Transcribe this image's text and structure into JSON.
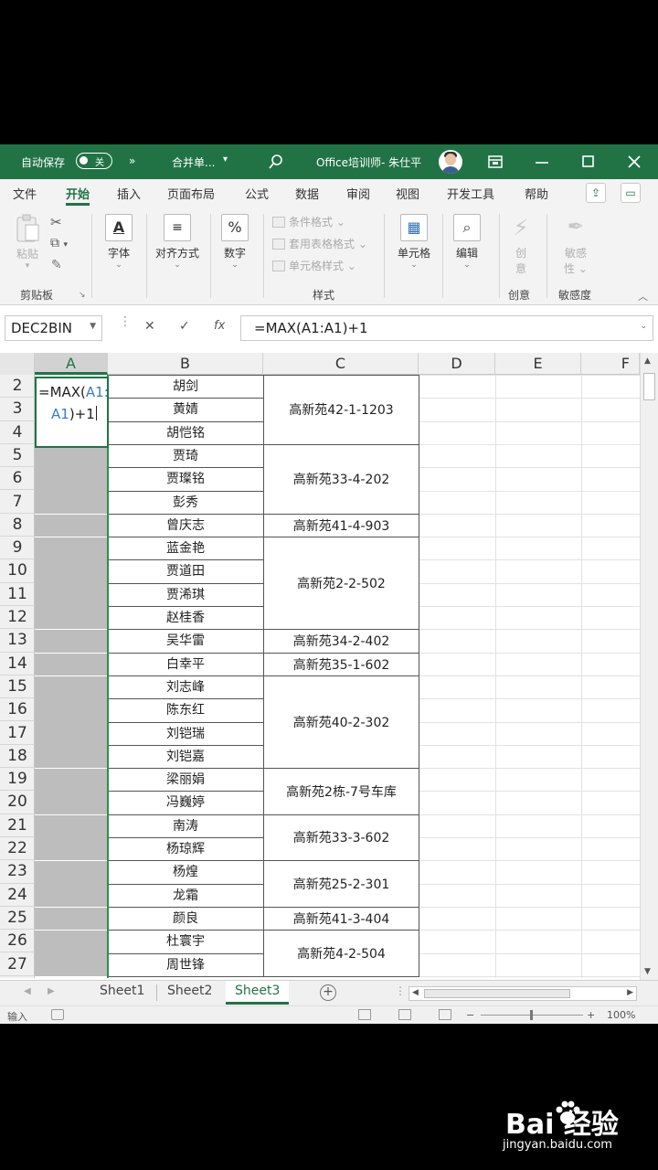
{
  "titlebar": {
    "autosave": "自动保存",
    "autosave_state": "关",
    "more": "»",
    "merge_menu": "合并单...",
    "merge_arrow": "▾",
    "doc_title": "Office培训师- 朱仕平",
    "colors": {
      "title_bg": "#217346"
    }
  },
  "tabs": [
    "文件",
    "开始",
    "插入",
    "页面布局",
    "公式",
    "数据",
    "审阅",
    "视图",
    "开发工具",
    "帮助"
  ],
  "active_tab": "开始",
  "ribbon": {
    "paste": "粘贴",
    "clipboard_group": "剪贴板",
    "font": "字体",
    "alignment": "对齐方式",
    "number": "数字",
    "cond_format": "条件格式",
    "table_format": "套用表格格式",
    "cell_style": "单元格样式",
    "styles_group": "样式",
    "cells": "单元格",
    "editing": "编辑",
    "ideas": "创意",
    "ideas_line1": "创",
    "ideas_line2": "意",
    "sensitivity": "敏感度",
    "sens_line1": "敏感",
    "sens_line2": "性",
    "percent": "%"
  },
  "formula_bar": {
    "name_box": "DEC2BIN",
    "cancel": "✕",
    "enter": "✓",
    "fx": "fx",
    "formula": "=MAX(A1:A1)+1"
  },
  "columns": [
    "A",
    "B",
    "C",
    "D",
    "E",
    "F"
  ],
  "rows": [
    "2",
    "3",
    "4",
    "5",
    "6",
    "7",
    "8",
    "9",
    "10",
    "11",
    "12",
    "13",
    "14",
    "15",
    "16",
    "17",
    "18",
    "19",
    "20",
    "21",
    "22",
    "23",
    "24",
    "25",
    "26",
    "27"
  ],
  "edit_cell": {
    "line1_prefix": "=MAX(",
    "line1_ref": "A1:",
    "line2_ref": "A1",
    "line2_suffix": ")+1"
  },
  "names": [
    "胡剑",
    "黄婧",
    "胡恺铭",
    "贾琦",
    "贾璨铭",
    "彭秀",
    "曾庆志",
    "蓝金艳",
    "贾道田",
    "贾浠琪",
    "赵桂香",
    "吴华雷",
    "白幸平",
    "刘志峰",
    "陈东红",
    "刘铠瑞",
    "刘铠嘉",
    "梁丽娟",
    "冯巍婷",
    "南涛",
    "杨琼辉",
    "杨煌",
    "龙霜",
    "颜良",
    "杜寰宇",
    "周世锋"
  ],
  "addresses": [
    "高新苑42-1-1203",
    "高新苑33-4-202",
    "高新苑41-4-903",
    "高新苑2-2-502",
    "高新苑34-2-402",
    "高新苑35-1-602",
    "高新苑40-2-302",
    "高新苑2栋-7号车库",
    "高新苑33-3-602",
    "高新苑25-2-301",
    "高新苑41-3-404",
    "高新苑4-2-504"
  ],
  "sheets": [
    "Sheet1",
    "Sheet2",
    "Sheet3"
  ],
  "active_sheet": "Sheet3",
  "status": {
    "mode": "输入",
    "zoom": "100%",
    "minus": "−",
    "plus": "+"
  },
  "watermark": {
    "logo": "Bai  经验",
    "url": "jingyan.baidu.com"
  }
}
